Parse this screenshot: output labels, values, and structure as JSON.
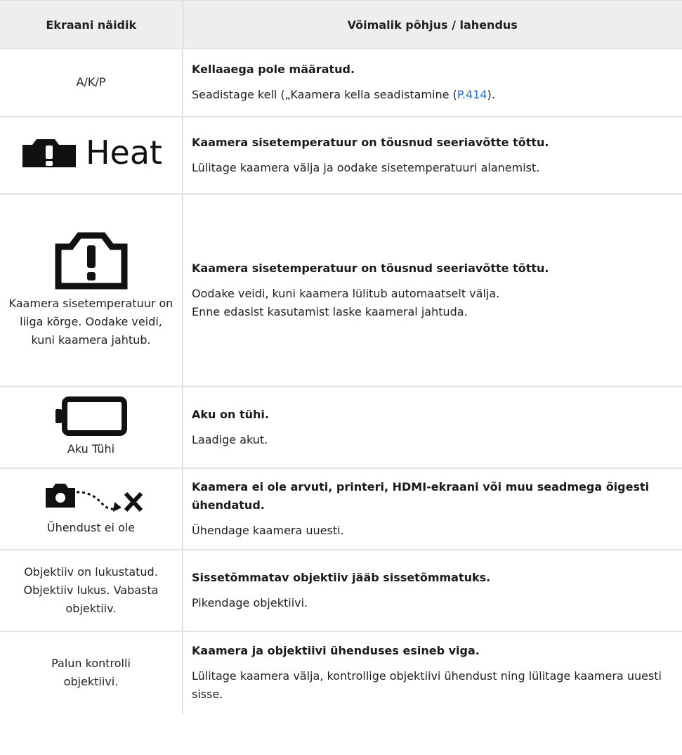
{
  "header": {
    "col1": "Ekraani näidik",
    "col2": "Võimalik põhjus / lahendus"
  },
  "rows": [
    {
      "symbol": "A/K/P",
      "cause": "Kellaaega pole määratud.",
      "fix_before": "Seadistage kell („Kaamera kella seadistamine (",
      "fix_link": "P.414",
      "fix_after": ")."
    },
    {
      "icon": "warning-heat-icon",
      "symbol": "Heat",
      "cause": "Kaamera sisetemperatuur on tõusnud seeriavõtte tõttu.",
      "fix": "Lülitage kaamera välja ja oodake sisetemperatuuri alanemist."
    },
    {
      "icon": "camera-warning-icon",
      "symbol": "Kaamera sisetemperatuur on liiga kõrge. Oodake veidi, kuni kaamera jahtub.",
      "cause": "Kaamera sisetemperatuur on tõusnud seeriavõtte tõttu.",
      "fix_line1": "Oodake veidi, kuni kaamera lülitub automaatselt välja.",
      "fix_line2": "Enne edasist kasutamist laske kaameral jahtuda."
    },
    {
      "icon": "battery-empty-icon",
      "symbol": "Aku Tühi",
      "cause": "Aku on tühi.",
      "fix": "Laadige akut."
    },
    {
      "icon": "camera-disconnected-icon",
      "symbol": "Ühendust ei ole",
      "cause": "Kaamera ei ole arvuti, printeri, HDMI-ekraani või muu seadmega õigesti ühendatud.",
      "fix": "Ühendage kaamera uuesti."
    },
    {
      "symbol": "Objektiiv on lukustatud. Objektiiv lukus. Vabasta objektiiv.",
      "cause": "Sissetõmmatav objektiiv jääb sissetõmmatuks.",
      "fix": "Pikendage objektiivi."
    },
    {
      "symbol": "Palun kontrolli objektiivi.",
      "cause": "Kaamera ja objektiivi ühenduses esineb viga.",
      "fix": "Lülitage kaamera välja, kontrollige objektiivi ühendust ning lülitage kaamera uuesti sisse."
    }
  ],
  "colors": {
    "header_bg": "#eeeeee",
    "link": "#1e6fd9",
    "border": "#e3e3e3"
  }
}
